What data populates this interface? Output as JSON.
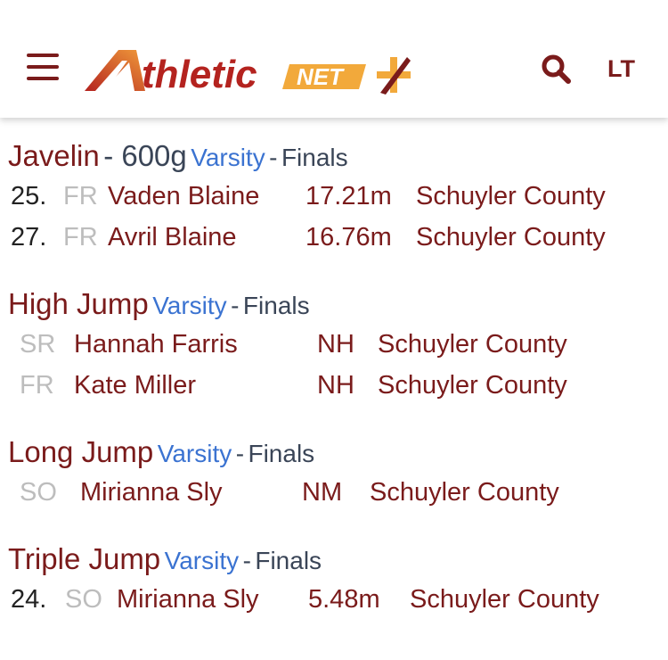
{
  "header": {
    "logo_text": "thletic",
    "logo_badge": "NET",
    "account_label": "LT",
    "icons": {
      "menu": "hamburger-menu-icon",
      "search": "search-icon",
      "plus": "plus-icon"
    }
  },
  "colors": {
    "brand_maroon": "#7a1b1b",
    "brand_orange": "#f2a93b",
    "level_blue": "#3b73d1",
    "muted_gray": "#bdbdbd",
    "slate": "#3a4557"
  },
  "events": [
    {
      "name": "Javelin",
      "weight": "- 600g",
      "level": "Varsity",
      "separator": "-",
      "round": "Finals",
      "results": [
        {
          "place": "25.",
          "grade": "FR",
          "athlete": "Vaden Blaine",
          "mark": "17.21m",
          "team": "Schuyler County"
        },
        {
          "place": "27.",
          "grade": "FR",
          "athlete": "Avril Blaine",
          "mark": "16.76m",
          "team": "Schuyler County"
        }
      ]
    },
    {
      "name": "High Jump",
      "level": "Varsity",
      "separator": "-",
      "round": "Finals",
      "results": [
        {
          "grade": "SR",
          "athlete": "Hannah Farris",
          "mark": "NH",
          "team": "Schuyler County"
        },
        {
          "grade": "FR",
          "athlete": "Kate Miller",
          "mark": "NH",
          "team": "Schuyler County"
        }
      ]
    },
    {
      "name": "Long Jump",
      "level": "Varsity",
      "separator": "-",
      "round": "Finals",
      "results": [
        {
          "grade": "SO",
          "athlete": "Mirianna Sly",
          "mark": "NM",
          "team": "Schuyler County"
        }
      ]
    },
    {
      "name": "Triple Jump",
      "level": "Varsity",
      "separator": "-",
      "round": "Finals",
      "results": [
        {
          "place": "24.",
          "grade": "SO",
          "athlete": "Mirianna Sly",
          "mark": "5.48m",
          "team": "Schuyler County"
        }
      ]
    }
  ]
}
